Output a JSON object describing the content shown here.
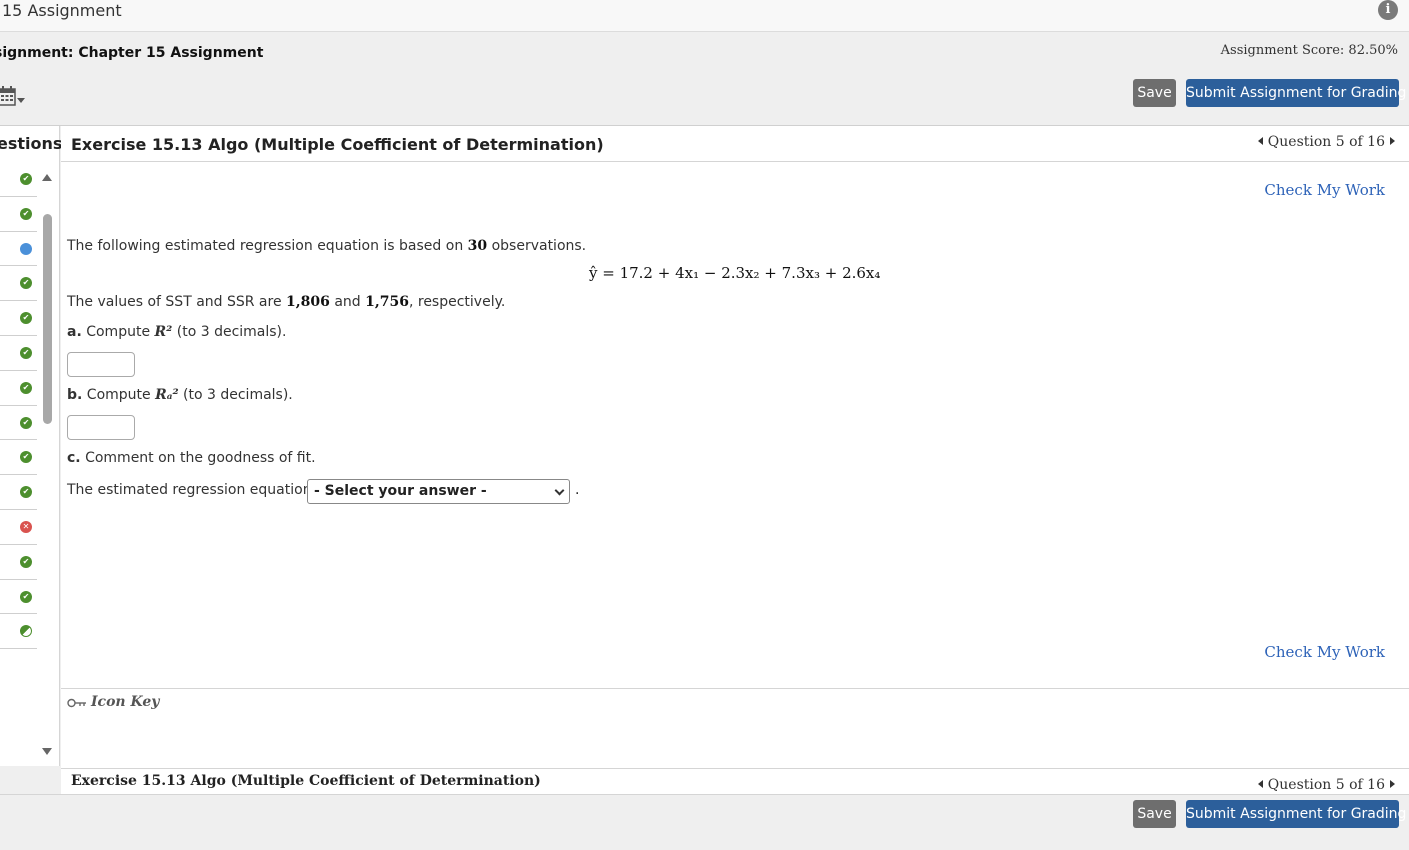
{
  "topbar": {
    "title": "15 Assignment",
    "info_icon": "info-icon",
    "info_glyph": "i"
  },
  "header": {
    "assignment_name": "signment: Chapter 15 Assignment",
    "score": "Assignment Score: 82.50%",
    "calendar_icon": "calendar-icon",
    "save_label": "Save",
    "submit_label": "Submit Assignment for Grading"
  },
  "sidebar": {
    "heading": "estions",
    "items": [
      {
        "status": "done",
        "glyph": "✔"
      },
      {
        "status": "done",
        "glyph": "✔"
      },
      {
        "status": "current",
        "glyph": ""
      },
      {
        "status": "done",
        "glyph": "✔"
      },
      {
        "status": "done",
        "glyph": "✔"
      },
      {
        "status": "done",
        "glyph": "✔"
      },
      {
        "status": "done",
        "glyph": "✔"
      },
      {
        "status": "done",
        "glyph": "✔"
      },
      {
        "status": "done",
        "glyph": "✔"
      },
      {
        "status": "done",
        "glyph": "✔"
      },
      {
        "status": "wrong",
        "glyph": "✕"
      },
      {
        "status": "done",
        "glyph": "✔"
      },
      {
        "status": "done",
        "glyph": "✔"
      },
      {
        "status": "partial",
        "glyph": ""
      }
    ]
  },
  "exercise": {
    "title": "Exercise 15.13 Algo (Multiple Coefficient of Determination)",
    "question_nav": "Question 5 of 16",
    "check_my_work": "Check My Work",
    "intro_pre": "The following estimated regression equation is based on ",
    "intro_num": "30",
    "intro_post": " observations.",
    "equation": "ŷ = 17.2 + 4x₁ − 2.3x₂ + 7.3x₃ + 2.6x₄",
    "values_pre": "The values of SST and SSR are ",
    "sst": "1,806",
    "values_mid": " and ",
    "ssr": "1,756",
    "values_post": ", respectively.",
    "part_a_label": "a.",
    "part_a_text": " Compute ",
    "part_a_sym": "R²",
    "part_a_suffix": " (to 3 decimals).",
    "part_b_label": "b.",
    "part_b_text": " Compute ",
    "part_b_sym": "Rₐ²",
    "part_b_suffix": " (to 3 decimals).",
    "part_c_label": "c.",
    "part_c_text": " Comment on the goodness of fit.",
    "select_prefix": "The estimated regression equation",
    "select_value": "- Select your answer -",
    "select_suffix": "."
  },
  "icon_key": {
    "label": "Icon Key"
  },
  "bottom": {
    "title": "Exercise 15.13 Algo (Multiple Coefficient of Determination)",
    "question_nav": "Question 5 of 16"
  },
  "footer": {
    "save_label": "Save",
    "submit_label": "Submit Assignment for Grading"
  },
  "colors": {
    "primary": "#2c5f9b",
    "save": "#6e6e6e",
    "done": "#4d8f2e",
    "current": "#4a90d9",
    "wrong": "#d9534f",
    "link": "#2e63b8"
  }
}
